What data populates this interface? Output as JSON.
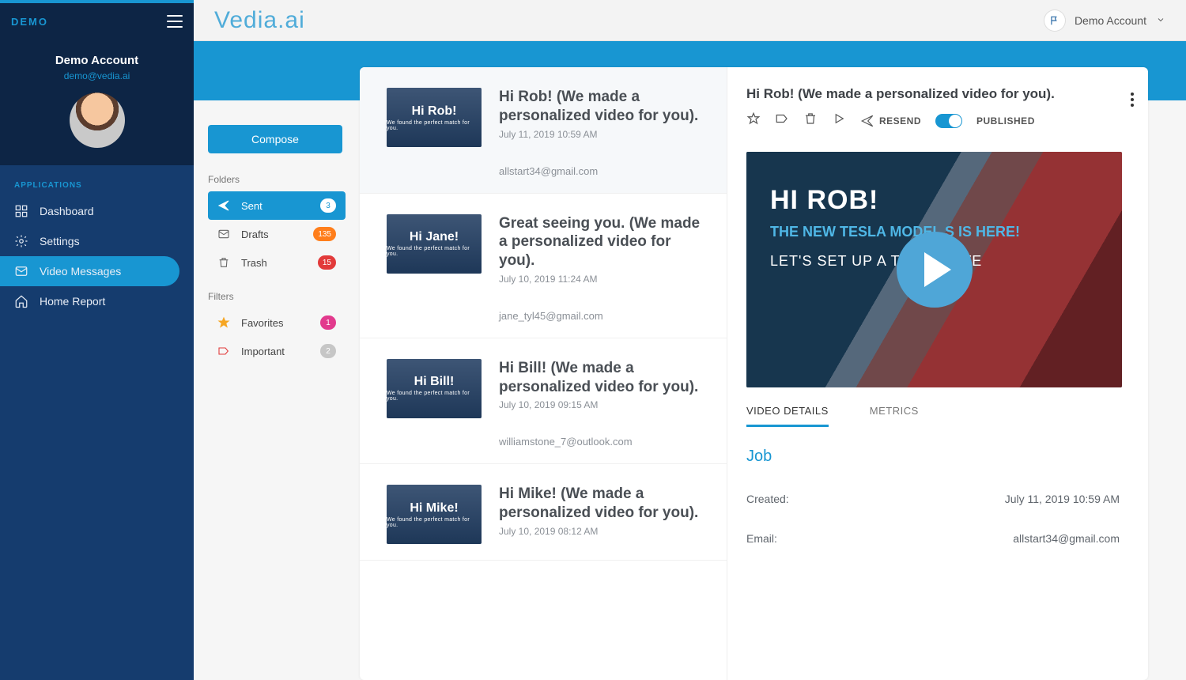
{
  "brand": "Vedia.ai",
  "topbar": {
    "user_name": "Demo Account"
  },
  "sidebar": {
    "demo_tag": "DEMO",
    "account_name": "Demo Account",
    "account_email": "demo@vedia.ai",
    "nav_heading": "APPLICATIONS",
    "items": [
      {
        "label": "Dashboard"
      },
      {
        "label": "Settings"
      },
      {
        "label": "Video Messages"
      },
      {
        "label": "Home Report"
      }
    ]
  },
  "folders": {
    "compose_label": "Compose",
    "folders_label": "Folders",
    "filters_label": "Filters",
    "items": [
      {
        "label": "Sent",
        "count": "3",
        "badge": "b-white",
        "active": true
      },
      {
        "label": "Drafts",
        "count": "135",
        "badge": "b-orange"
      },
      {
        "label": "Trash",
        "count": "15",
        "badge": "b-red"
      }
    ],
    "filters": [
      {
        "label": "Favorites",
        "count": "1",
        "badge": "b-pink"
      },
      {
        "label": "Important",
        "count": "2",
        "badge": "b-grey"
      }
    ]
  },
  "messages": [
    {
      "thumb_name": "Hi Rob!",
      "thumb_sub": "We found the perfect match for you.",
      "title": "Hi Rob! (We made a personalized video for you).",
      "date": "July 11, 2019 10:59 AM",
      "email": "allstart34@gmail.com",
      "selected": true
    },
    {
      "thumb_name": "Hi Jane!",
      "thumb_sub": "We found the perfect match for you.",
      "title": "Great seeing you. (We made a personalized video for you).",
      "date": "July 10, 2019 11:24 AM",
      "email": "jane_tyl45@gmail.com"
    },
    {
      "thumb_name": "Hi Bill!",
      "thumb_sub": "We found the perfect match for you.",
      "title": "Hi Bill! (We made a personalized video for you).",
      "date": "July 10, 2019 09:15 AM",
      "email": "williamstone_7@outlook.com"
    },
    {
      "thumb_name": "Hi Mike!",
      "thumb_sub": "We found the perfect match for you.",
      "title": "Hi Mike! (We made a personalized video for you).",
      "date": "July 10, 2019 08:12 AM",
      "email": ""
    }
  ],
  "detail": {
    "title": "Hi Rob! (We made a personalized video for you).",
    "resend_label": "RESEND",
    "published_label": "PUBLISHED",
    "video": {
      "line1": "HI ROB!",
      "line2": "THE NEW TESLA MODEL S IS HERE!",
      "line3": "LET'S SET UP A TEST DRIVE"
    },
    "tabs": [
      "VIDEO DETAILS",
      "METRICS"
    ],
    "section_heading": "Job",
    "rows": [
      {
        "k": "Created:",
        "v": "July 11, 2019 10:59 AM"
      },
      {
        "k": "Email:",
        "v": "allstart34@gmail.com"
      }
    ]
  }
}
